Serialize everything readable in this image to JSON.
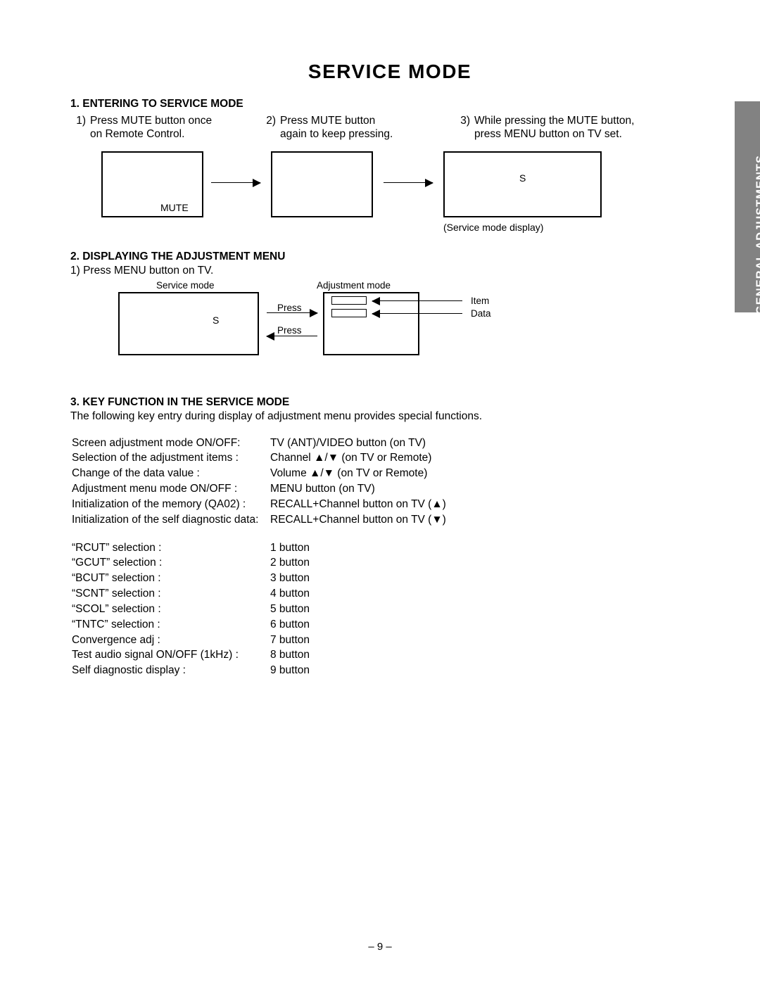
{
  "sideTab": "GENERAL ADJUSTMENTS",
  "title": "SERVICE  MODE",
  "sec1": {
    "head": "1. ENTERING TO SERVICE MODE",
    "step1_num": "1)",
    "step1a": "Press MUTE button once",
    "step1b": "on Remote Control.",
    "step2_num": "2)",
    "step2a": "Press MUTE button",
    "step2b": "again to keep pressing.",
    "step3_num": "3)",
    "step3a": "While pressing the MUTE button,",
    "step3b": "press MENU button on TV set.",
    "box1_label": "MUTE",
    "box3_label": "S",
    "box3_caption": "(Service mode display)"
  },
  "sec2": {
    "head": "2. DISPLAYING THE ADJUSTMENT MENU",
    "line": "1)  Press MENU button on TV.",
    "lblService": "Service mode",
    "lblAdj": "Adjustment mode",
    "sLabel": "S",
    "press1": "Press",
    "press2": "Press",
    "item": "Item",
    "data": "Data"
  },
  "sec3": {
    "head": "3. KEY FUNCTION IN THE SERVICE MODE",
    "intro": "The following key entry during display of adjustment menu provides special functions.",
    "rowsA": [
      {
        "l": "Screen adjustment mode ON/OFF:",
        "r": "TV (ANT)/VIDEO button (on TV)"
      },
      {
        "l": "Selection of the adjustment items :",
        "r": "Channel ▲/▼ (on TV or Remote)"
      },
      {
        "l": "Change of the data value :",
        "r": "Volume ▲/▼ (on TV or Remote)"
      },
      {
        "l": "Adjustment menu mode ON/OFF :",
        "r": "MENU button (on TV)"
      },
      {
        "l": "Initialization of the memory (QA02) :",
        "r": "RECALL+Channel button on TV (▲)"
      },
      {
        "l": "Initialization of the self diagnostic data:",
        "r": "RECALL+Channel button on TV (▼)"
      }
    ],
    "rowsB": [
      {
        "l": "“RCUT” selection :",
        "r": "1 button"
      },
      {
        "l": "“GCUT” selection :",
        "r": "2 button"
      },
      {
        "l": "“BCUT” selection :",
        "r": "3 button"
      },
      {
        "l": "“SCNT” selection :",
        "r": "4 button"
      },
      {
        "l": "“SCOL” selection :",
        "r": "5 button"
      },
      {
        "l": "“TNTC” selection :",
        "r": "6 button"
      },
      {
        "l": "Convergence adj :",
        "r": "7 button"
      },
      {
        "l": "Test audio signal ON/OFF (1kHz) :",
        "r": "8 button"
      },
      {
        "l": "Self diagnostic display :",
        "r": "9 button"
      }
    ]
  },
  "pageNum": "– 9 –"
}
